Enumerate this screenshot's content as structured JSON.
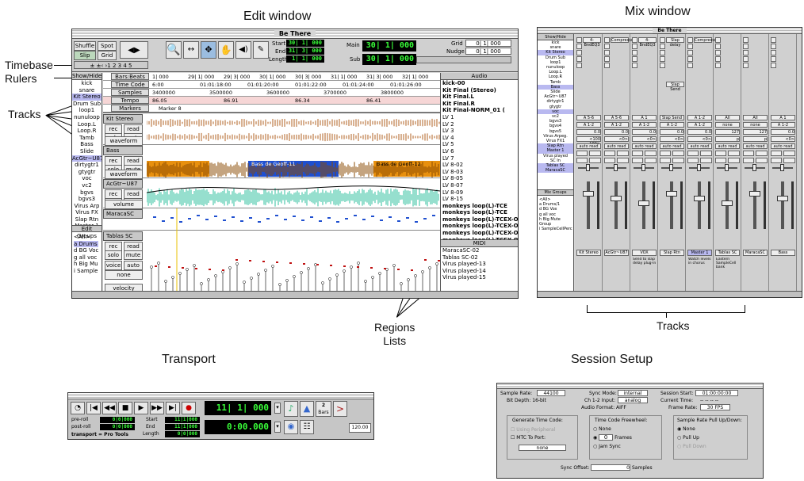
{
  "captions": {
    "edit_window": "Edit window",
    "mix_window": "Mix window",
    "timebase_rulers": "Timebase\nRulers",
    "tracks_left": "Tracks",
    "regions_lists": "Regions\nLists",
    "tracks_bottom": "Tracks",
    "transport": "Transport",
    "session_setup": "Session Setup"
  },
  "edit": {
    "title": "Be There",
    "modes": [
      "Shuffle",
      "Spot",
      "Slip",
      "Grid"
    ],
    "start_label": "Start",
    "end_label": "End",
    "length_label": "Length",
    "start_val": "30| 1| 000",
    "end_val": "31| 3| 000",
    "length_val": "1| 1| 000",
    "main_label": "Main",
    "sub_label": "Sub",
    "main_val": "30| 1| 000",
    "sub_val": "30| 1| 000",
    "grid_label": "Grid",
    "nudge_label": "Nudge",
    "grid_val": "0| 1| 000",
    "nudge_val": "0| 1| 000",
    "show_hide": "Show/Hide",
    "track_list": [
      "kick",
      "snare",
      "Kit Stereo",
      "Drum Sub",
      "loop1",
      "nunuloop",
      "Loop.L",
      "Loop.R",
      "Tamb",
      "Bass",
      "Slide",
      "AcGtr~U87",
      "dirtygtr1",
      "gtygtr",
      "voc",
      "vc2",
      "bgvs",
      "bgvs3",
      "Virus Arp",
      "Virus FX",
      "Slap Rtn",
      "Master 1"
    ],
    "edit_groups": "Edit Groups",
    "groups": [
      "<All>",
      "a Drums",
      "d BG Voc",
      "g all voc",
      "h Big Mu",
      "i Sample"
    ],
    "rulers": [
      {
        "name": "Bars:Beats",
        "marks": [
          "1| 000",
          "29| 1| 000",
          "29| 3| 000",
          "30| 1| 000",
          "30| 3| 000",
          "31| 1| 000",
          "31| 3| 000",
          "32| 1| 000"
        ]
      },
      {
        "name": "Time Code",
        "marks": [
          "6:00",
          "01:01:18:00",
          "01:01:20:00",
          "01:01:22:00",
          "01:01:24:00",
          "01:01:26:00"
        ]
      },
      {
        "name": "Samples",
        "marks": [
          "3400000",
          "3500000",
          "3600000",
          "3700000",
          "3800000"
        ]
      },
      {
        "name": "Tempo",
        "marks": [
          "86.05",
          "86.91",
          "86.34",
          "86.41"
        ]
      },
      {
        "name": "Markers",
        "marks": [
          "Marker 8"
        ]
      }
    ],
    "tracks": [
      {
        "name": "Kit Stereo",
        "b1": "rec",
        "b2": "read",
        "b3": "solo",
        "b4": "mute",
        "b5": "voice",
        "b6": "auto",
        "view": "waveform"
      },
      {
        "name": "Bass",
        "b1": "rec",
        "b2": "read",
        "b3": "solo",
        "b4": "mute",
        "b5": "voice",
        "b6": "auto",
        "view": "waveform"
      },
      {
        "name": "AcGtr~U87",
        "b1": "rec",
        "b2": "read",
        "b3": "solo",
        "b4": "mute",
        "b5": "voice",
        "b6": "auto",
        "view": "volume"
      },
      {
        "name": "MaracaSC",
        "b1": "",
        "b2": "",
        "b3": "",
        "b4": "",
        "b5": "",
        "b6": "",
        "view": ""
      },
      {
        "name": "Tablas SC",
        "b1": "rec",
        "b2": "read",
        "b3": "solo",
        "b4": "mute",
        "b5": "voice",
        "b6": "auto",
        "view": "velocity"
      }
    ],
    "regions": [
      "Bass de Geoff-11",
      "Bass de Geoff-12"
    ],
    "none_label": "none",
    "audio_header": "Audio",
    "audio_list": [
      "kick-00",
      "Kit Final (Stereo)",
      "Kit Final.L",
      "Kit Final.R",
      "Kit Final-NORM_01 (",
      "LV 1",
      "LV 2",
      "LV 3",
      "LV 4",
      "LV 5",
      "LV 6",
      "LV 7",
      "LV 8-02",
      "LV 8-03",
      "LV 8-05",
      "LV 8-07",
      "LV 8-09",
      "LV 8-15",
      "monkeys loop(L)-TCE",
      "monkeys loop(L)-TCE",
      "monkeys loop(L)-TCEX-O",
      "monkeys loop(L)-TCEX-O",
      "monkeys loop(L)-TCEX-O",
      "monkeys loop(L)-TCEX-O",
      "monkeys loop(L)-TCEX-O"
    ],
    "midi_header": "MIDI",
    "midi_list": [
      "MaracaSC-02",
      "Tablas SC-02",
      "Virus played-13",
      "Virus played-14",
      "Virus played-15"
    ]
  },
  "mix": {
    "title": "Be There",
    "show_hide": "Show/Hide",
    "track_list": [
      "kick",
      "snare",
      "Kit Stereo",
      "Drum Sub",
      "loop1",
      "nunuloop",
      "Loop.L",
      "Loop.R",
      "Tamb",
      "Bass",
      "Slide",
      "AcGtr~U87",
      "dirtygtr1",
      "gtygtr",
      "voc",
      "vc2",
      "bgvs3",
      "bgvs4",
      "bgvs5",
      "Virus Arpeg.",
      "Virus FX1",
      "Slap Rtn",
      "Master 1",
      "Virus played",
      "SC In",
      "Tablas SC",
      "MaracaSC"
    ],
    "mix_groups": "Mix Groups",
    "groups": [
      "<All>",
      "a Drums/1",
      "d BG Vox",
      "g all voc",
      "h Big Mute Group",
      "i SampleCellPerc"
    ],
    "inserts": [
      "4-BndEQ3",
      "Compressor",
      "4-BndEQ3",
      "Slap delay",
      "Compressor"
    ],
    "send": "Slap Send",
    "strips": [
      {
        "io1": "A 5-6",
        "io2": "A 1-2",
        "vol": "0.0",
        "pan": "<100 100>",
        "auto": "auto read",
        "name": "Kit Stereo",
        "comment": ""
      },
      {
        "io1": "A 5-6",
        "io2": "A 1-2",
        "vol": "0.0",
        "pan": "<0>",
        "auto": "auto read",
        "name": "AcGtr~U87",
        "comment": ""
      },
      {
        "io1": "A 1",
        "io2": "A 1-2",
        "vol": "0.0",
        "pan": "<0>",
        "auto": "auto read",
        "name": "VOX",
        "comment": "Send to slap delay plug-in"
      },
      {
        "io1": "Slap Send",
        "io2": "A 1-2",
        "vol": "0.0",
        "pan": "<0>",
        "auto": "auto read",
        "name": "Slap Rtn",
        "comment": ""
      },
      {
        "io1": "A 1-2",
        "io2": "A 1-2",
        "vol": "0.0",
        "pan": "<0>",
        "auto": "auto read",
        "name": "Master 1",
        "comment": "Watch levels in chorus"
      },
      {
        "io1": "All",
        "io2": "none",
        "vol": "127",
        "pan": "p",
        "auto": "auto read",
        "name": "Tablas SC",
        "comment": "Eastern SampleCell bank"
      },
      {
        "io1": "All",
        "io2": "none",
        "vol": "127",
        "pan": "p",
        "auto": "auto read",
        "name": "MaracaSC",
        "comment": ""
      },
      {
        "io1": "A 1",
        "io2": "A 1-2",
        "vol": "0.0",
        "pan": "<0>",
        "auto": "auto read",
        "name": "Bass",
        "comment": ""
      }
    ]
  },
  "transport": {
    "preroll_label": "pre-roll",
    "postroll_label": "post-roll",
    "start_label": "Start",
    "end_label": "End",
    "length_label": "Length",
    "preroll": "0|0|000",
    "postroll": "0|0|000",
    "start": "11|1|000",
    "end": "11|1|000",
    "length": "0|0|000",
    "main": "11| 1| 000",
    "sub": "0:00.000",
    "status": "transport = Pro Tools",
    "meter_num": "2",
    "meter_unit": "Bars",
    "tempo": "120.00"
  },
  "session": {
    "sample_rate_label": "Sample Rate:",
    "sample_rate": "44100",
    "bit_depth": "Bit Depth: 16-bit",
    "sync_mode_label": "Sync Mode:",
    "sync_mode": "internal",
    "ch_input_label": "Ch 1-2 Input:",
    "ch_input": "analog",
    "audio_format": "Audio Format: AIFF",
    "session_start_label": "Session Start:",
    "session_start": "01:00:00:00",
    "current_time_label": "Current Time:",
    "current_time": "-- -- -- --",
    "frame_rate_label": "Frame Rate:",
    "frame_rate": "30 FPS",
    "gen_tc_label": "Generate Time Code:",
    "using_peripheral": "Using Peripheral",
    "mtc_to_port": "MTC To Port:",
    "port": "none",
    "freewheel_label": "Time Code Freewheel:",
    "fw_none": "None",
    "fw_frames_val": "0",
    "fw_frames": "Frames",
    "jam_sync": "Jam Sync",
    "pullup_label": "Sample Rate Pull Up/Down:",
    "pu_none": "None",
    "pull_up": "Pull Up",
    "pull_down": "Pull Down",
    "sync_offset_label": "Sync Offset:",
    "sync_offset": "0",
    "samples": "Samples"
  }
}
